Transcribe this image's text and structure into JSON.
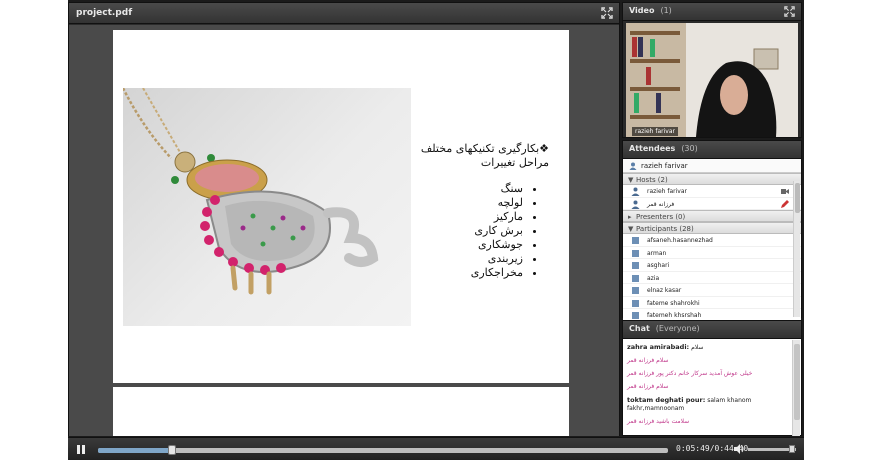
{
  "document_pod": {
    "title": "project.pdf",
    "slide": {
      "heading_line1": "❖بکارگیری تکنیکهای مختلف",
      "heading_line2": "مراحل تغییرات",
      "bullets": [
        "سنگ",
        "لولچه",
        "مارکیز",
        "برش کاری",
        "جوشکاری",
        "زیربندی",
        "مخراجکاری"
      ]
    }
  },
  "player": {
    "time": "0:05:49/0:44:40",
    "progress_fraction": 0.13,
    "volume_fraction": 0.92
  },
  "video_pod": {
    "title": "Video",
    "count": "(1)",
    "presenter_name": "razieh farivar"
  },
  "attendees_pod": {
    "title": "Attendees",
    "count": "(30)",
    "current_user": "razieh farivar",
    "hosts_label": "Hosts (2)",
    "hosts": [
      "razieh farivar",
      "فرزانه قمر"
    ],
    "presenters_label": "Presenters (0)",
    "participants_label": "Participants (28)",
    "participants": [
      "afsaneh.hasannezhad",
      "arman",
      "asghari",
      "azia",
      "elnaz kasar",
      "fateme shahrokhi",
      "fatemeh khsrshah"
    ]
  },
  "chat_pod": {
    "title": "Chat",
    "scope": "(Everyone)",
    "messages": [
      {
        "sender": "zahra amirabadi:",
        "text": "سلام"
      },
      {
        "sender": "",
        "text": "سلام فرزانه قمر"
      },
      {
        "sender": "",
        "text": "خیلی عوش آمدید سرکار خانم دکتر پور فرزانه قمر"
      },
      {
        "sender": "",
        "text": "سلام فرزانه قمر"
      },
      {
        "sender": "toktam deghati pour:",
        "text": "salam khanom fakhr,mamnoonam"
      },
      {
        "sender": "",
        "text": "سلامت باشید فرزانه قمر"
      }
    ]
  },
  "colors": {
    "pod_header": "#3a3a3a",
    "chat_highlight": "#c0378a",
    "progress": "#7fa6c8"
  },
  "icons": [
    "fullscreen-icon",
    "pause-icon",
    "volume-icon",
    "user-icon",
    "host-icon",
    "webcam-icon",
    "pencil-icon"
  ]
}
